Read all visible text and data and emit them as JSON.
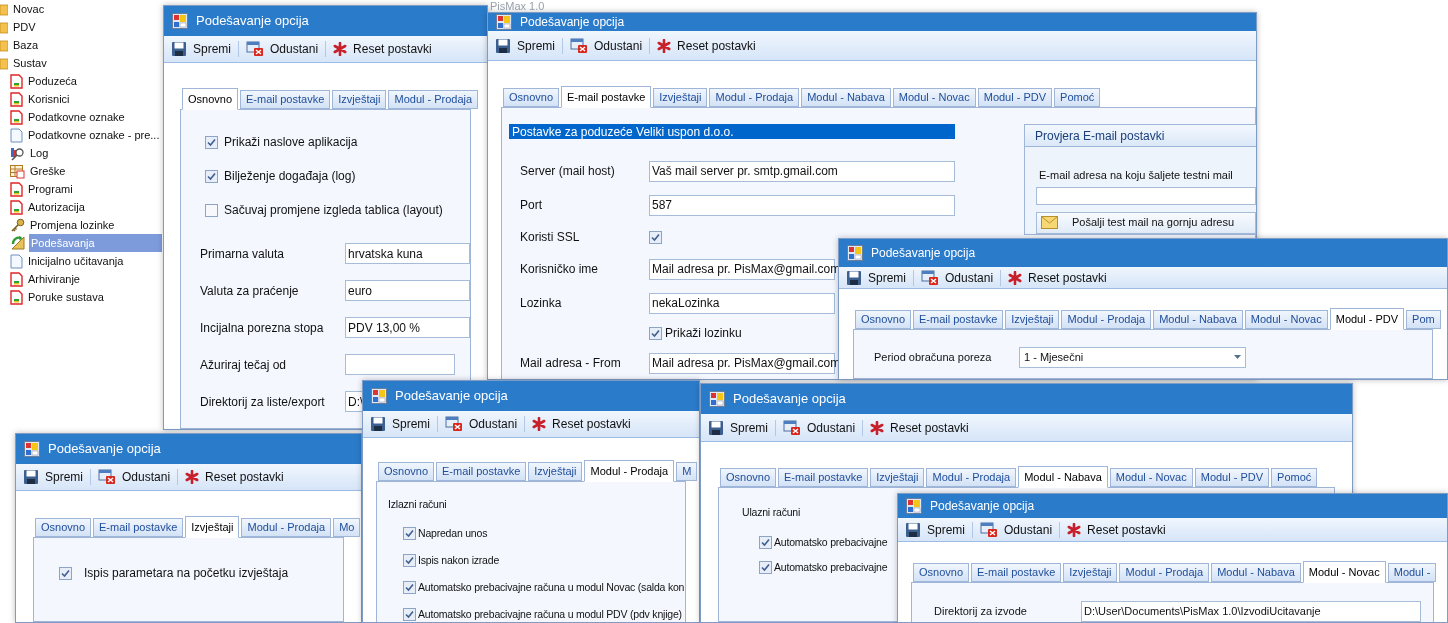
{
  "sidebar": {
    "items": [
      {
        "label": "Novac",
        "kind": "folder",
        "selected": false
      },
      {
        "label": "PDV",
        "kind": "folder",
        "selected": false
      },
      {
        "label": "Baza",
        "kind": "folder",
        "selected": false
      },
      {
        "label": "Sustav",
        "kind": "folder",
        "selected": false,
        "children": [
          {
            "label": "Poduzeća",
            "kind": "form",
            "selected": false
          },
          {
            "label": "Korisnici",
            "kind": "form",
            "selected": false
          },
          {
            "label": "Podatkovne oznake",
            "kind": "form",
            "selected": false
          },
          {
            "label": "Podatkovne oznake - pre...",
            "kind": "page",
            "selected": false
          },
          {
            "label": "Log",
            "kind": "log",
            "selected": false
          },
          {
            "label": "Greške",
            "kind": "table",
            "selected": false
          },
          {
            "label": "Programi",
            "kind": "form",
            "selected": false
          },
          {
            "label": "Autorizacija",
            "kind": "form",
            "selected": false
          },
          {
            "label": "Promjena lozinke",
            "kind": "key",
            "selected": false
          },
          {
            "label": "Podešavanja",
            "kind": "tools",
            "selected": true
          },
          {
            "label": "Inicijalno učitavanja",
            "kind": "page",
            "selected": false
          },
          {
            "label": "Arhiviranje",
            "kind": "form",
            "selected": false
          },
          {
            "label": "Poruke sustava",
            "kind": "form",
            "selected": false
          }
        ]
      }
    ]
  },
  "app_caption": "PisMax 1.0",
  "windows": [
    {
      "title": "Podešavanje opcija",
      "toolbar": [
        {
          "label": "Spremi",
          "kind": "save"
        },
        {
          "label": "Odustani",
          "kind": "cancel"
        },
        {
          "label": "Reset postavki",
          "kind": "reset"
        }
      ],
      "tabs": [
        {
          "label": "Osnovno",
          "selected": true
        },
        {
          "label": "E-mail postavke",
          "selected": false
        },
        {
          "label": "Izvještaji",
          "selected": false
        },
        {
          "label": "Modul - Prodaja",
          "selected": false
        }
      ],
      "rows": [
        {
          "kind": "check",
          "label": "Prikaži naslove aplikacija",
          "checked": true
        },
        {
          "kind": "check",
          "label": "Bilježenje događaja (log)",
          "checked": true
        },
        {
          "kind": "check",
          "label": "Sačuvaj promjene izgleda tablica (layout)",
          "checked": false
        },
        {
          "kind": "field",
          "label": "Primarna valuta",
          "value": "hrvatska kuna"
        },
        {
          "kind": "field",
          "label": "Valuta za praćenje",
          "value": "euro"
        },
        {
          "kind": "field",
          "label": "Incijalna porezna stopa",
          "value": "PDV 13,00 %"
        },
        {
          "kind": "field",
          "label": "Ažuriraj tečaj od"
        },
        {
          "kind": "field",
          "label": "Direktorij za liste/export",
          "value": "D:\\"
        }
      ]
    },
    {
      "title": "Podešavanje opcija",
      "toolbar": [
        {
          "label": "Spremi",
          "kind": "save"
        },
        {
          "label": "Odustani",
          "kind": "cancel"
        },
        {
          "label": "Reset postavki",
          "kind": "reset"
        }
      ],
      "tabs": [
        {
          "label": "Osnovno",
          "selected": false
        },
        {
          "label": "E-mail postavke",
          "selected": true
        },
        {
          "label": "Izvještaji",
          "selected": false
        },
        {
          "label": "Modul - Prodaja",
          "selected": false
        },
        {
          "label": "Modul - Nabava",
          "selected": false
        },
        {
          "label": "Modul - Novac",
          "selected": false
        },
        {
          "label": "Modul - PDV",
          "selected": false
        },
        {
          "label": "Pomoć",
          "selected": false
        }
      ],
      "rows": [
        {
          "kind": "banner",
          "text": "Postavke za poduzeće Veliki uspon d.o.o."
        },
        {
          "kind": "field",
          "label": "Server (mail host)",
          "value": "Vaš mail server pr. smtp.gmail.com"
        },
        {
          "kind": "field",
          "label": "Port",
          "value": "587"
        },
        {
          "kind": "checkfield",
          "label": "Koristi SSL",
          "checked": true
        },
        {
          "kind": "field",
          "label": "Korisničko ime",
          "value": "Mail adresa pr. PisMax@gmail.com"
        },
        {
          "kind": "field",
          "label": "Lozinka",
          "value": "nekaLozinka"
        },
        {
          "kind": "check",
          "label": "Prikaži lozinku",
          "checked": true
        },
        {
          "kind": "field",
          "label": "Mail adresa - From",
          "value": "Mail adresa pr. PisMax@gmail.com"
        }
      ],
      "group": {
        "title": "Provjera E-mail postavki",
        "label": "E-mail adresa na koju šaljete testni mail",
        "button": "Pošalji test mail na gornju adresu"
      }
    },
    {
      "title": "Podešavanje opcija",
      "toolbar": [
        {
          "label": "Spremi",
          "kind": "save"
        },
        {
          "label": "Odustani",
          "kind": "cancel"
        },
        {
          "label": "Reset postavki",
          "kind": "reset"
        }
      ],
      "tabs": [
        {
          "label": "Osnovno",
          "selected": false
        },
        {
          "label": "E-mail postavke",
          "selected": false
        },
        {
          "label": "Izvještaji",
          "selected": false
        },
        {
          "label": "Modul - Prodaja",
          "selected": false
        },
        {
          "label": "Modul - Nabava",
          "selected": false
        },
        {
          "label": "Modul - Novac",
          "selected": false
        },
        {
          "label": "Modul - PDV",
          "selected": true
        },
        {
          "label": "Pom",
          "selected": false
        }
      ],
      "rows": [
        {
          "kind": "select",
          "label": "Period obračuna poreza",
          "value": "1 - Mjesečni"
        }
      ]
    },
    {
      "title": "Podešavanje opcija",
      "toolbar": [
        {
          "label": "Spremi",
          "kind": "save"
        },
        {
          "label": "Odustani",
          "kind": "cancel"
        },
        {
          "label": "Reset postavki",
          "kind": "reset"
        }
      ],
      "tabs": [
        {
          "label": "Osnovno",
          "selected": false
        },
        {
          "label": "E-mail postavke",
          "selected": false
        },
        {
          "label": "Izvještaji",
          "selected": true
        },
        {
          "label": "Modul - Prodaja",
          "selected": false
        },
        {
          "label": "Mo",
          "selected": false
        }
      ],
      "rows": [
        {
          "kind": "check",
          "label": "Ispis parametara na početku izvještaja",
          "checked": true
        }
      ]
    },
    {
      "title": "Podešavanje opcija",
      "toolbar": [
        {
          "label": "Spremi",
          "kind": "save"
        },
        {
          "label": "Odustani",
          "kind": "cancel"
        },
        {
          "label": "Reset postavki",
          "kind": "reset"
        }
      ],
      "tabs": [
        {
          "label": "Osnovno",
          "selected": false
        },
        {
          "label": "E-mail postavke",
          "selected": false
        },
        {
          "label": "Izvještaji",
          "selected": false
        },
        {
          "label": "Modul - Prodaja",
          "selected": true
        },
        {
          "label": "M",
          "selected": false
        }
      ],
      "rows": [
        {
          "kind": "heading",
          "text": "Izlazni računi"
        },
        {
          "kind": "check",
          "label": "Napredan unos",
          "checked": true
        },
        {
          "kind": "check",
          "label": "Ispis nakon izrade",
          "checked": true
        },
        {
          "kind": "check",
          "label": "Automatsko prebacivajne računa u modul Novac (salda kon",
          "checked": true
        },
        {
          "kind": "check",
          "label": "Automatsko prebacivajne računa u modul PDV (pdv knjige)",
          "checked": true
        }
      ]
    },
    {
      "title": "Podešavanje opcija",
      "toolbar": [
        {
          "label": "Spremi",
          "kind": "save"
        },
        {
          "label": "Odustani",
          "kind": "cancel"
        },
        {
          "label": "Reset postavki",
          "kind": "reset"
        }
      ],
      "tabs": [
        {
          "label": "Osnovno",
          "selected": false
        },
        {
          "label": "E-mail postavke",
          "selected": false
        },
        {
          "label": "Izvještaji",
          "selected": false
        },
        {
          "label": "Modul - Prodaja",
          "selected": false
        },
        {
          "label": "Modul - Nabava",
          "selected": true
        },
        {
          "label": "Modul - Novac",
          "selected": false
        },
        {
          "label": "Modul - PDV",
          "selected": false
        },
        {
          "label": "Pomoć",
          "selected": false
        }
      ],
      "rows": [
        {
          "kind": "heading",
          "text": "Ulazni računi"
        },
        {
          "kind": "check",
          "label": "Automatsko prebacivajne",
          "checked": true
        },
        {
          "kind": "check",
          "label": "Automatsko prebacivajne",
          "checked": true
        }
      ]
    },
    {
      "title": "Podešavanje opcija",
      "toolbar": [
        {
          "label": "Spremi",
          "kind": "save"
        },
        {
          "label": "Odustani",
          "kind": "cancel"
        },
        {
          "label": "Reset postavki",
          "kind": "reset"
        }
      ],
      "tabs": [
        {
          "label": "Osnovno",
          "selected": false
        },
        {
          "label": "E-mail postavke",
          "selected": false
        },
        {
          "label": "Izvještaji",
          "selected": false
        },
        {
          "label": "Modul - Prodaja",
          "selected": false
        },
        {
          "label": "Modul - Nabava",
          "selected": false
        },
        {
          "label": "Modul - Novac",
          "selected": true
        },
        {
          "label": "Modul - ",
          "selected": false
        }
      ],
      "rows": [
        {
          "kind": "field",
          "label": "Direktorij za izvode",
          "value": "D:\\User\\Documents\\PisMax 1.0\\IzvodiUcitavanje"
        }
      ]
    }
  ]
}
